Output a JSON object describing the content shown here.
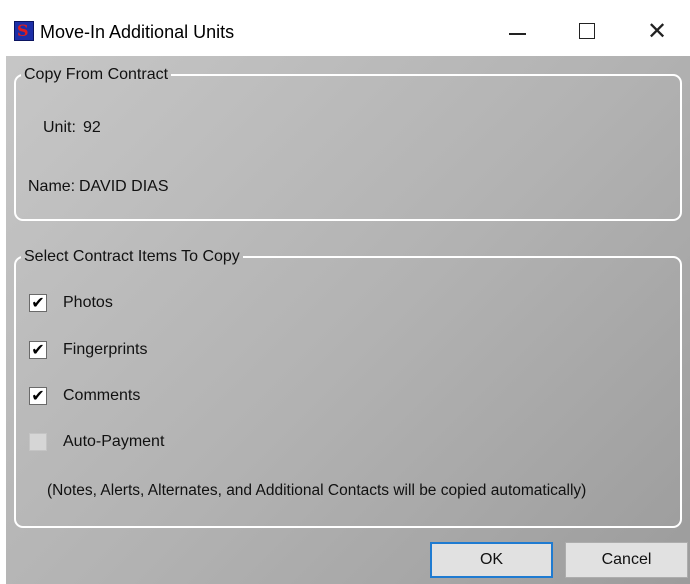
{
  "window": {
    "title": "Move-In Additional Units",
    "icon": "app-s-logo-icon",
    "controls": {
      "minimize": "minimize-icon",
      "maximize": "maximize-icon",
      "close": "close-icon"
    }
  },
  "copy_from": {
    "legend": "Copy From Contract",
    "unit_label": "Unit:",
    "unit_value": "92",
    "name_label": "Name:",
    "name_value": "DAVID DIAS"
  },
  "select_items": {
    "legend": "Select Contract Items To Copy",
    "items": [
      {
        "label": "Photos",
        "checked": true,
        "enabled": true
      },
      {
        "label": "Fingerprints",
        "checked": true,
        "enabled": true
      },
      {
        "label": "Comments",
        "checked": true,
        "enabled": true
      },
      {
        "label": "Auto-Payment",
        "checked": false,
        "enabled": false
      }
    ],
    "note": "(Notes, Alerts, Alternates, and Additional Contacts will be copied automatically)"
  },
  "buttons": {
    "ok": "OK",
    "cancel": "Cancel"
  }
}
